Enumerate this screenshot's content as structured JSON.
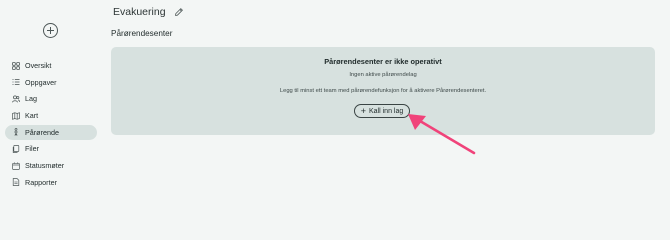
{
  "header": {
    "title": "Evakuering",
    "subtitle": "Pårørendesenter"
  },
  "sidebar": {
    "items": [
      {
        "label": "Oversikt",
        "icon": "grid-icon"
      },
      {
        "label": "Oppgaver",
        "icon": "list-icon"
      },
      {
        "label": "Lag",
        "icon": "users-icon"
      },
      {
        "label": "Kart",
        "icon": "map-icon"
      },
      {
        "label": "Pårørende",
        "icon": "person-icon",
        "active": true
      },
      {
        "label": "Filer",
        "icon": "files-icon"
      },
      {
        "label": "Statusmøter",
        "icon": "calendar-icon"
      },
      {
        "label": "Rapporter",
        "icon": "report-icon"
      }
    ]
  },
  "panel": {
    "heading": "Pårørendesenter er ikke operativt",
    "sub": "Ingen aktive pårørendelag",
    "hint": "Legg til minst ett team med pårørendefunksjon for å aktivere Pårørendesenteret.",
    "button_label": "Kall inn lag"
  },
  "colors": {
    "background": "#f3f6f5",
    "panel": "#d7e1df",
    "active_nav": "#d7e1df",
    "annotation_arrow": "#f0437a"
  }
}
